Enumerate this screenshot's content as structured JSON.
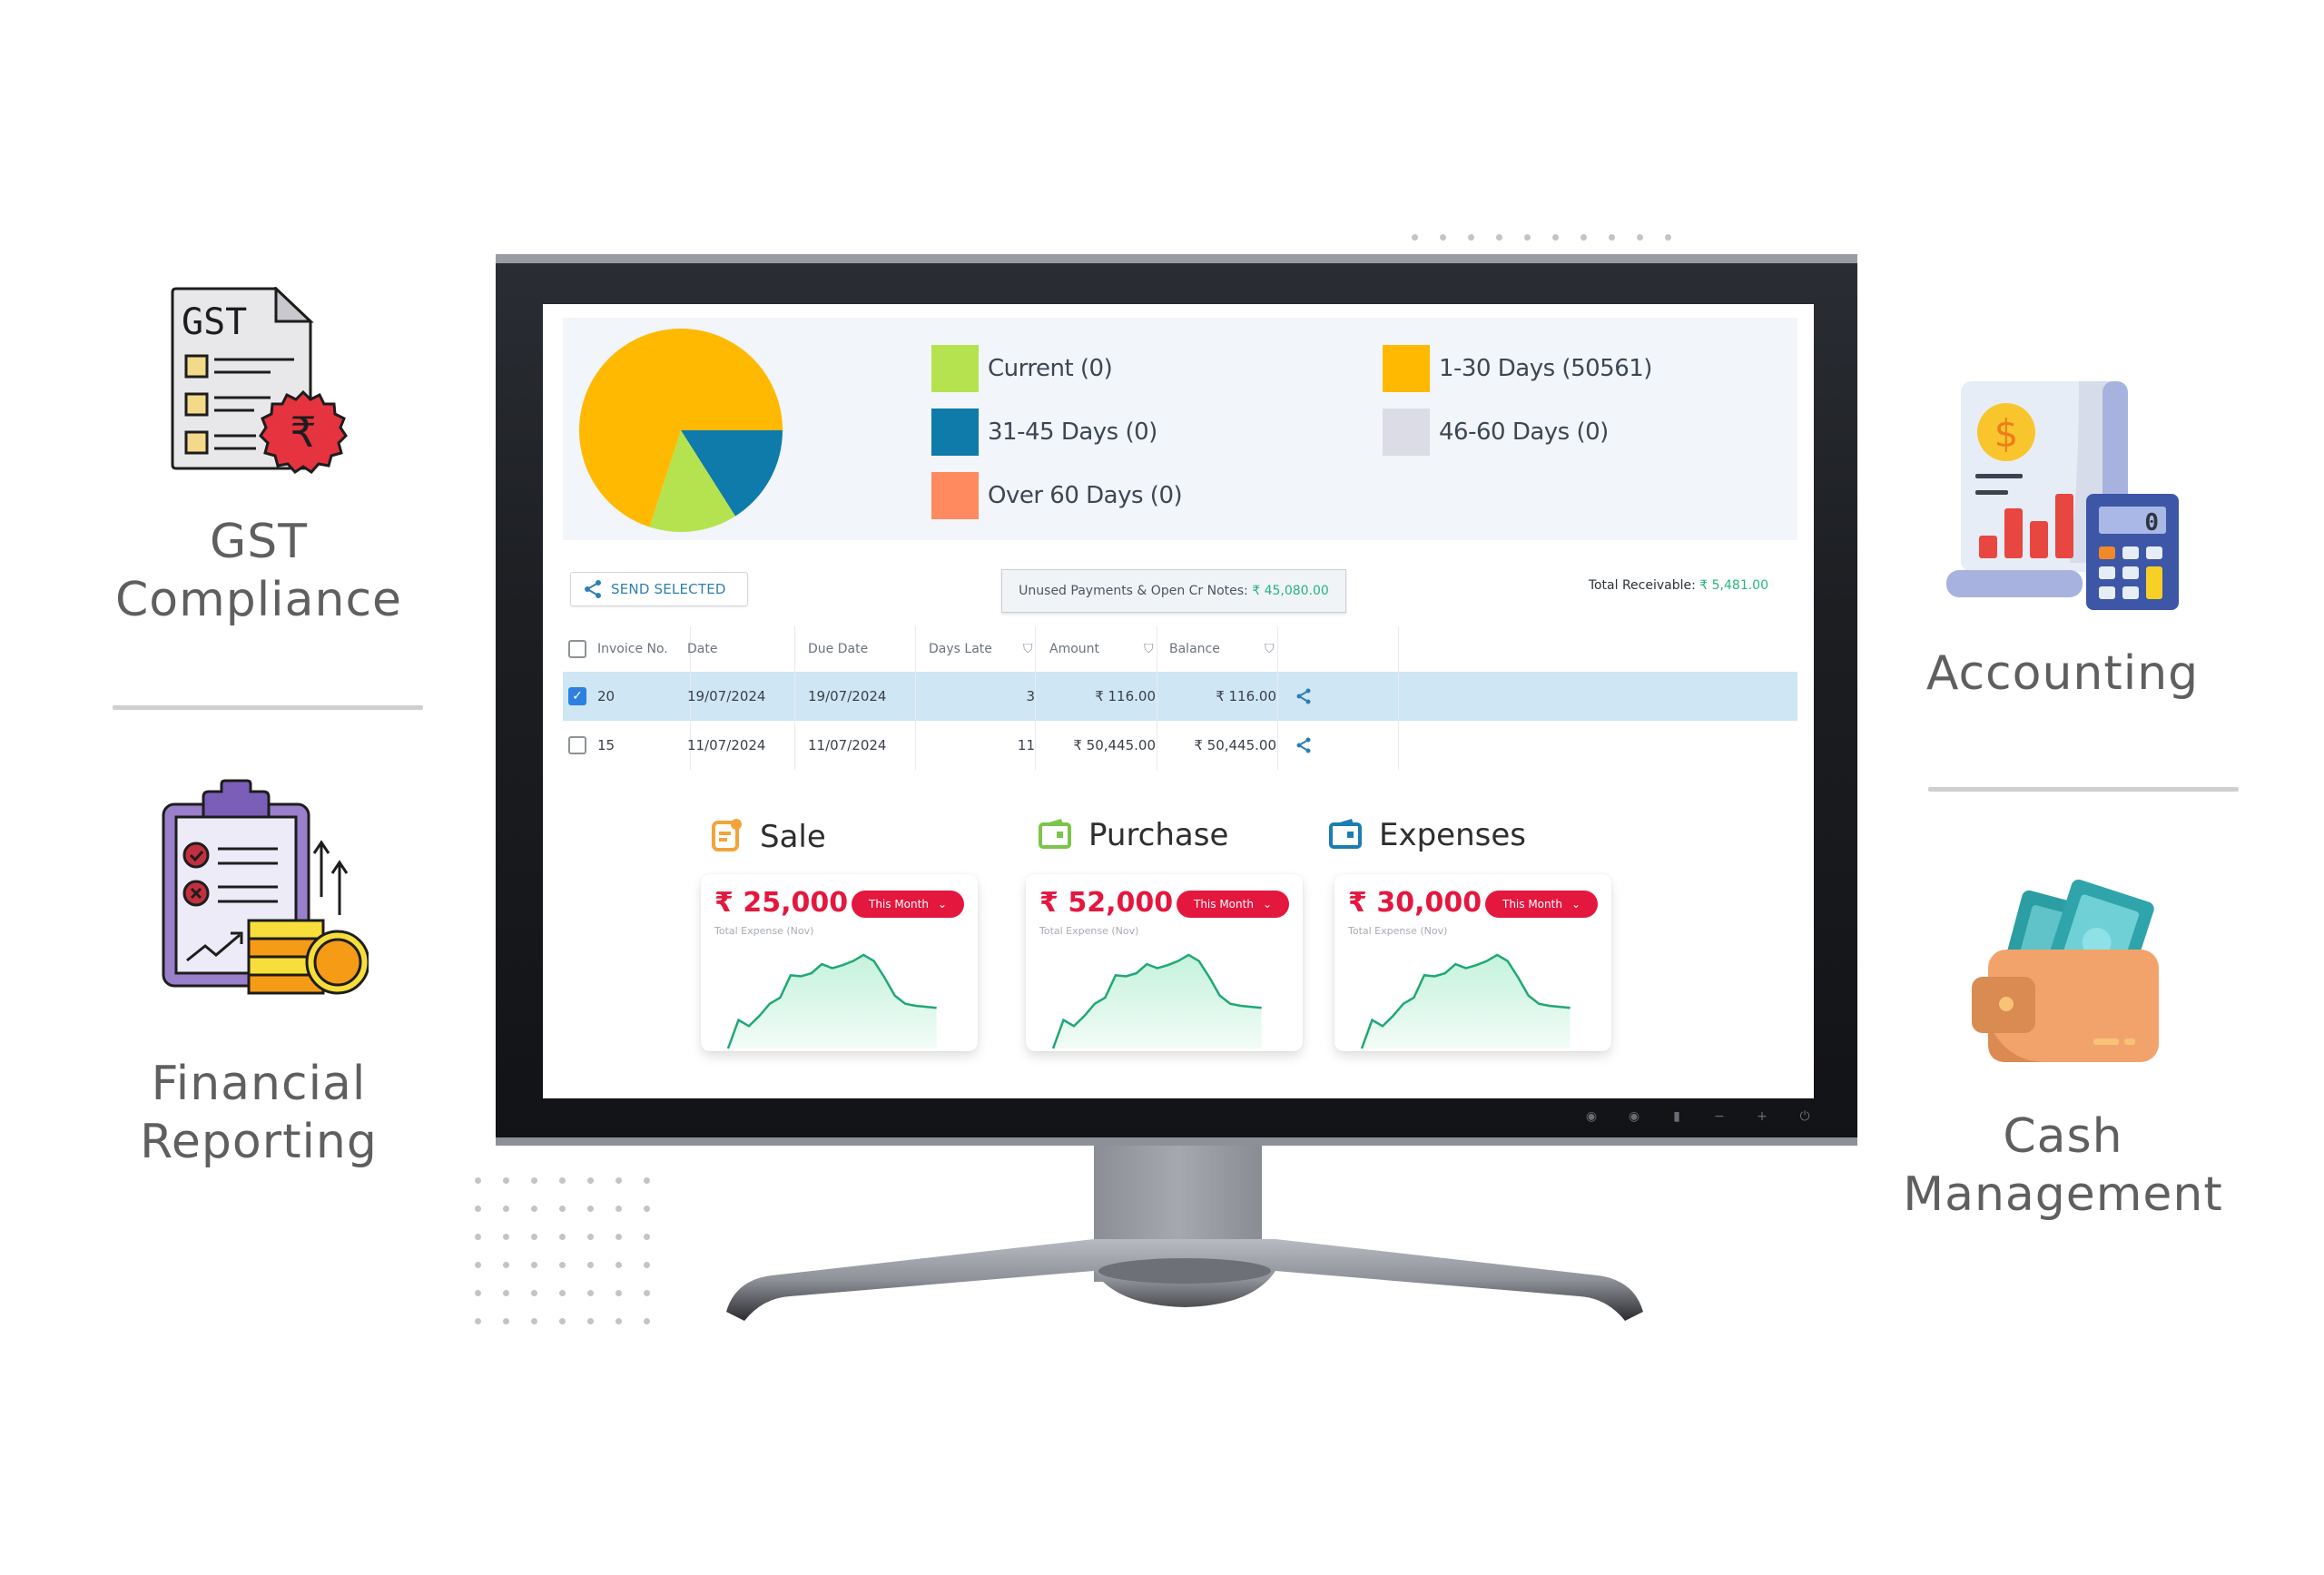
{
  "features": {
    "gst": {
      "line1": "GST",
      "line2": "Compliance",
      "icon": "gst-document-icon"
    },
    "financial": {
      "line1": "Financial",
      "line2": "Reporting",
      "icon": "clipboard-coins-icon"
    },
    "accounting": {
      "line1": "Accounting",
      "icon": "calculator-report-icon"
    },
    "cash": {
      "line1": "Cash",
      "line2": "Management",
      "icon": "wallet-cash-icon"
    }
  },
  "gst_icon_text": "GST",
  "calculator_display": "0",
  "aging": {
    "legend": [
      {
        "label": "Current (0)",
        "color": "#b5e350"
      },
      {
        "label": "1-30 Days (50561)",
        "color": "#ffb900"
      },
      {
        "label": "31-45 Days (0)",
        "color": "#0e7bab"
      },
      {
        "label": "46-60 Days (0)",
        "color": "#dcdce6"
      },
      {
        "label": "Over 60 Days (0)",
        "color": "#ff8a60"
      }
    ]
  },
  "chart_data": [
    {
      "type": "pie",
      "title": "",
      "categories": [
        "1-30 Days",
        "31-45 Days",
        "Current"
      ],
      "values": [
        0.7,
        0.16,
        0.14
      ],
      "colors": [
        "#ffb900",
        "#0e7bab",
        "#b5e350"
      ],
      "legend": [
        "Current (0)",
        "1-30 Days (50561)",
        "31-45 Days (0)",
        "46-60 Days (0)",
        "Over 60 Days (0)"
      ],
      "legend_placement": "right"
    },
    {
      "type": "area",
      "title": "Sale",
      "x": [
        0,
        1,
        2,
        3,
        4,
        5,
        6,
        7,
        8,
        9,
        10,
        11,
        12,
        13,
        14,
        15,
        16,
        17,
        18,
        19,
        20
      ],
      "values": [
        0,
        0.28,
        0.22,
        0.32,
        0.44,
        0.5,
        0.72,
        0.71,
        0.74,
        0.83,
        0.79,
        0.82,
        0.86,
        0.92,
        0.86,
        0.7,
        0.52,
        0.44,
        0.42,
        0.41,
        0.4
      ],
      "xlabel": "",
      "ylabel": "",
      "grid": false
    },
    {
      "type": "area",
      "title": "Purchase",
      "x": [
        0,
        1,
        2,
        3,
        4,
        5,
        6,
        7,
        8,
        9,
        10,
        11,
        12,
        13,
        14,
        15,
        16,
        17,
        18,
        19,
        20
      ],
      "values": [
        0,
        0.28,
        0.22,
        0.32,
        0.44,
        0.5,
        0.72,
        0.71,
        0.74,
        0.83,
        0.79,
        0.82,
        0.86,
        0.92,
        0.86,
        0.7,
        0.52,
        0.44,
        0.42,
        0.41,
        0.4
      ],
      "xlabel": "",
      "ylabel": "",
      "grid": false
    },
    {
      "type": "area",
      "title": "Expenses",
      "x": [
        0,
        1,
        2,
        3,
        4,
        5,
        6,
        7,
        8,
        9,
        10,
        11,
        12,
        13,
        14,
        15,
        16,
        17,
        18,
        19,
        20
      ],
      "values": [
        0,
        0.28,
        0.22,
        0.32,
        0.44,
        0.5,
        0.72,
        0.71,
        0.74,
        0.83,
        0.79,
        0.82,
        0.86,
        0.92,
        0.86,
        0.7,
        0.52,
        0.44,
        0.42,
        0.41,
        0.4
      ],
      "xlabel": "",
      "ylabel": "",
      "grid": false
    }
  ],
  "toolbar": {
    "send_selected": "SEND SELECTED",
    "unused_label": "Unused Payments & Open Cr Notes:",
    "unused_value": "₹ 45,080.00",
    "total_label": "Total Receivable:",
    "total_value": "₹ 5,481.00"
  },
  "table": {
    "headers": [
      "Invoice No.",
      "Date",
      "Due Date",
      "Days Late",
      "Amount",
      "Balance"
    ],
    "rows": [
      {
        "selected": true,
        "invoice": "20",
        "date": "19/07/2024",
        "due": "19/07/2024",
        "days_late": "3",
        "amount": "₹ 116.00",
        "balance": "₹ 116.00"
      },
      {
        "selected": false,
        "invoice": "15",
        "date": "11/07/2024",
        "due": "11/07/2024",
        "days_late": "11",
        "amount": "₹ 50,445.00",
        "balance": "₹ 50,445.00"
      }
    ]
  },
  "cards": [
    {
      "title": "Sale",
      "amount": "₹ 25,000",
      "period": "This Month",
      "subtitle": "Total Expense (Nov)",
      "icon_color": "#f2a43a"
    },
    {
      "title": "Purchase",
      "amount": "₹ 52,000",
      "period": "This Month",
      "subtitle": "Total Expense (Nov)",
      "icon_color": "#7cc44a"
    },
    {
      "title": "Expenses",
      "amount": "₹ 30,000",
      "period": "This Month",
      "subtitle": "Total Expense (Nov)",
      "icon_color": "#1b7db5"
    }
  ],
  "colors": {
    "accent_red": "#e4173f",
    "accent_green": "#26b57a",
    "line_green": "#1fa874",
    "link_blue": "#2f7fb1"
  }
}
